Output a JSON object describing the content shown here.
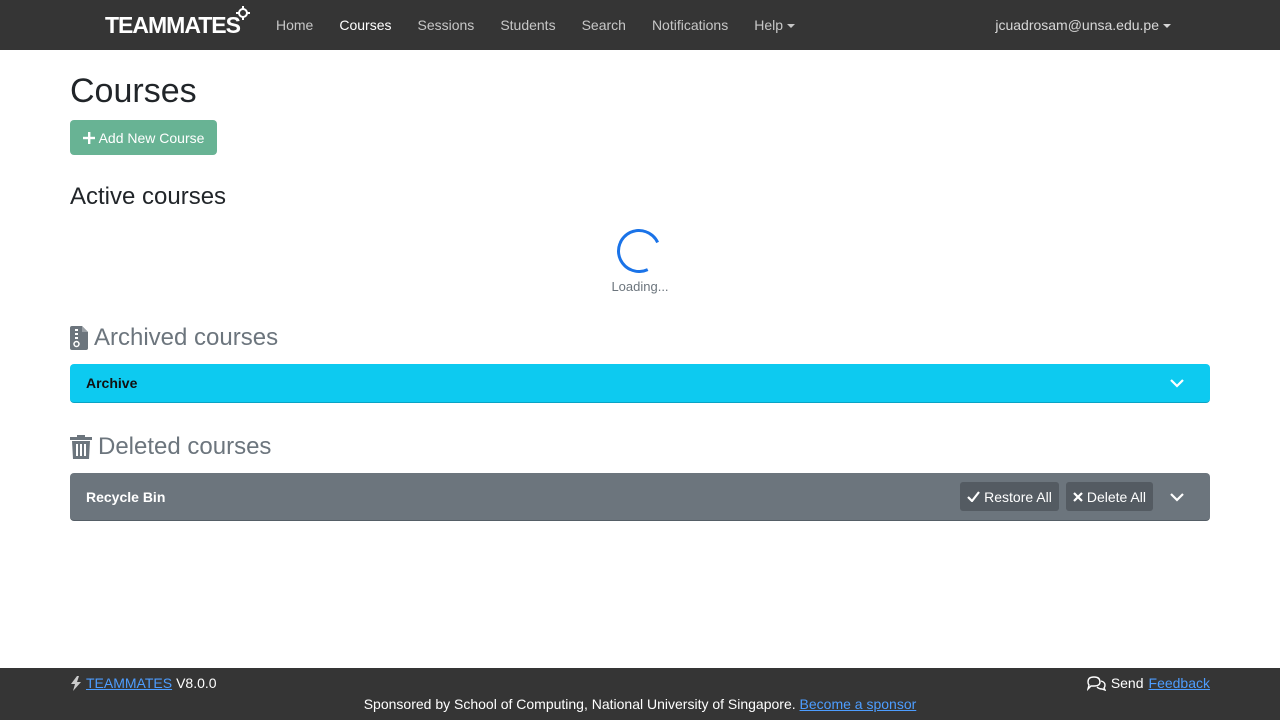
{
  "navbar": {
    "brand": "TEAMMATES",
    "links": [
      "Home",
      "Courses",
      "Sessions",
      "Students",
      "Search",
      "Notifications",
      "Help"
    ],
    "active": "Courses",
    "user": "jcuadrosam@unsa.edu.pe"
  },
  "main": {
    "title": "Courses",
    "add_button": "Add New Course",
    "active_heading": "Active courses",
    "loading_text": "Loading...",
    "archived_heading": "Archived courses",
    "archive_panel_label": "Archive",
    "deleted_heading": "Deleted courses",
    "recycle_panel_label": "Recycle Bin",
    "restore_all": "Restore All",
    "delete_all": "Delete All"
  },
  "footer": {
    "brand_link": "TEAMMATES",
    "version": "V8.0.0",
    "send": "Send",
    "feedback_link": "Feedback",
    "sponsor_text": "Sponsored by School of Computing, National University of Singapore.",
    "sponsor_link": "Become a sponsor"
  },
  "colors": {
    "navbar": "#353535",
    "add_button": "#68b394",
    "archive_panel": "#0dcaf0",
    "recycle_panel": "#6c757d",
    "spinner": "#1a73e8",
    "link": "#4d9dff"
  }
}
